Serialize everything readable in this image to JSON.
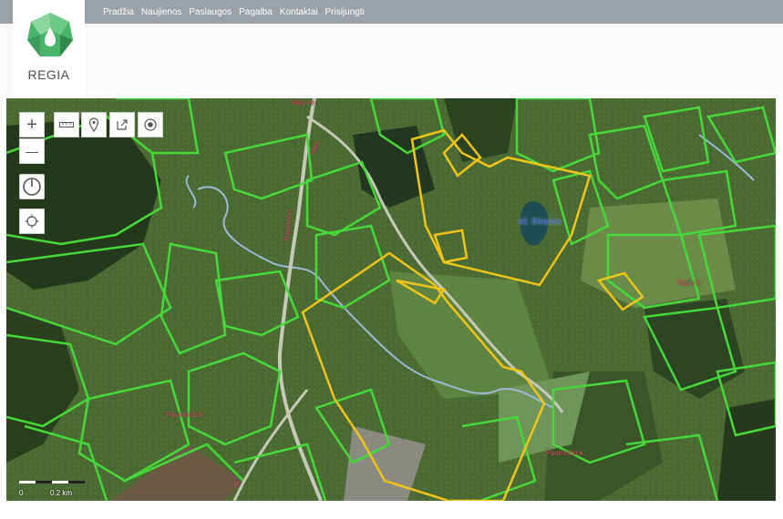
{
  "nav": {
    "items": [
      "Pradžia",
      "Naujienos",
      "Paslaugos",
      "Pagalba",
      "Kontaktai",
      "Prisijungti"
    ]
  },
  "logo": {
    "text": "REGIA"
  },
  "map": {
    "labels": {
      "road_vajuzu": "Vajų ve.",
      "road_vaju_vertical": "Vajų",
      "road_pavirincio": "Pavirinčio",
      "lake": "ež. Bikardis",
      "village_eglių": "Eglių k.",
      "village_pavirincio_left": "Pavirinčio k.",
      "village_pavirincio_right": "Pavirinčio k.",
      "road_bottom": "P"
    },
    "scale": {
      "zero": "0",
      "distance": "0.2 km"
    },
    "colors": {
      "parcel_outline": "#45d93a",
      "selected_outline": "#f0c419",
      "river": "#9fb8d8",
      "road": "#c6c8b8"
    }
  },
  "tools": {
    "zoom_in": "+",
    "zoom_out": "—"
  }
}
